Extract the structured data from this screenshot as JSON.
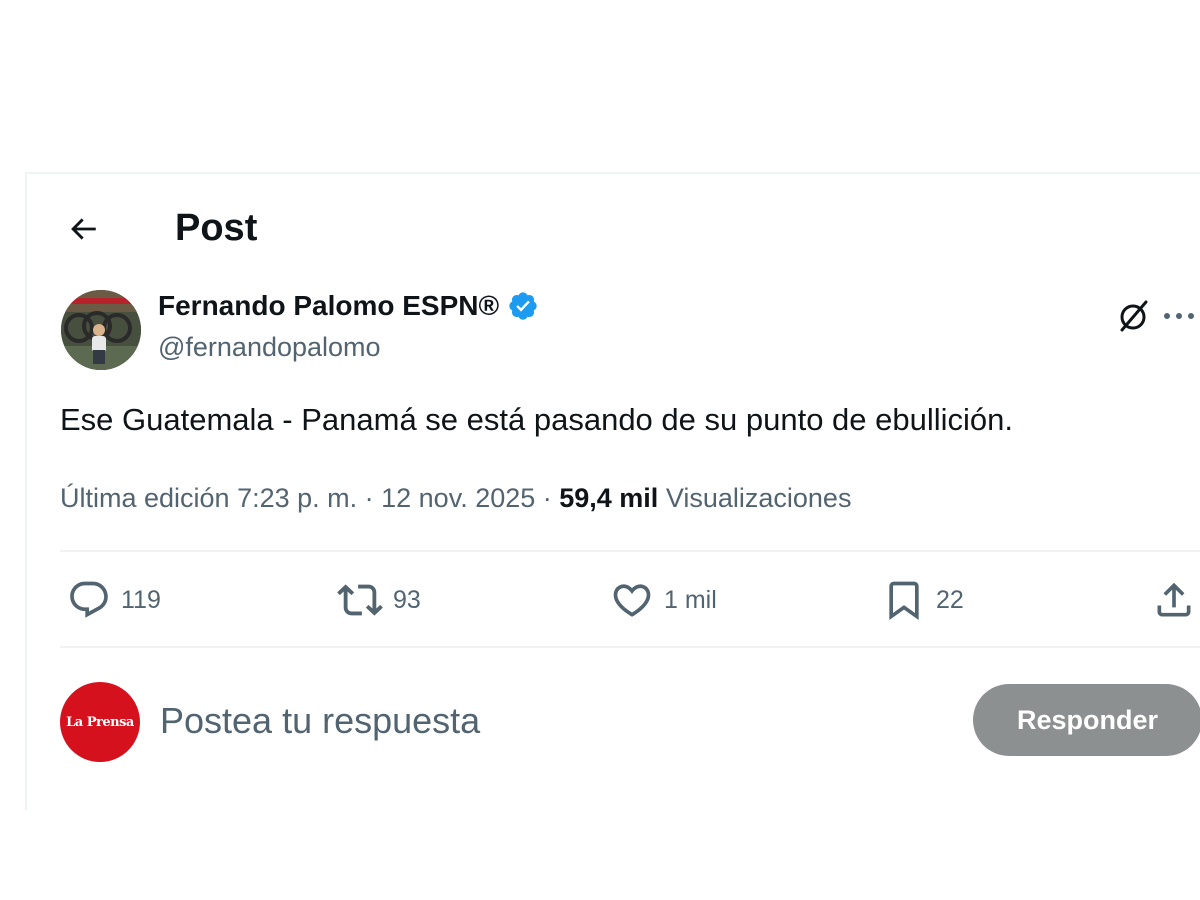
{
  "header": {
    "title": "Post"
  },
  "author": {
    "name": "Fernando Palomo ESPN®",
    "handle": "@fernandopalomo",
    "verified": true,
    "verified_color": "#1d9bf0"
  },
  "tweet": {
    "text": "Ese Guatemala - Panamá se está pasando de su punto de ebullición.",
    "meta_prefix": "Última edición 7:23 p. m. · 12 nov. 2025 · ",
    "views_count": "59,4 mil",
    "views_label": "Visualizaciones"
  },
  "actions": {
    "replies": "119",
    "reposts": "93",
    "likes": "1 mil",
    "bookmarks": "22"
  },
  "reply": {
    "avatar_text": "La Prensa",
    "placeholder": "Postea tu respuesta",
    "button_label": "Responder"
  },
  "icons": {
    "back": "back-arrow-icon",
    "grok": "grok-icon",
    "more": "more-icon",
    "reply": "reply-icon",
    "repost": "repost-icon",
    "like": "heart-icon",
    "bookmark": "bookmark-icon",
    "share": "share-icon"
  },
  "colors": {
    "text_primary": "#0f1419",
    "text_secondary": "#536471",
    "divider": "#eff3f4",
    "reply_button_bg": "#8d9091",
    "reply_avatar_bg": "#d4111d"
  }
}
